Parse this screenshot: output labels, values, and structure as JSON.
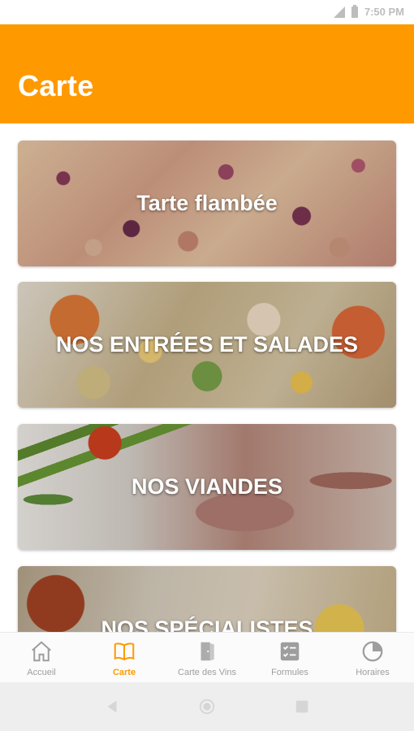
{
  "status_bar": {
    "time": "7:50 PM"
  },
  "app_bar": {
    "title": "Carte"
  },
  "colors": {
    "accent": "#ff9900",
    "inactive": "#9e9e9e"
  },
  "menu": [
    {
      "label": "Tarte flambée"
    },
    {
      "label": "NOS ENTRÉES ET SALADES"
    },
    {
      "label": "NOS VIANDES"
    },
    {
      "label": "NOS SPÉCIALISTES"
    }
  ],
  "bottom_nav": [
    {
      "label": "Accueil",
      "icon": "home-icon",
      "active": false
    },
    {
      "label": "Carte",
      "icon": "book-icon",
      "active": true
    },
    {
      "label": "Carte des Vins",
      "icon": "door-icon",
      "active": false
    },
    {
      "label": "Formules",
      "icon": "checklist-icon",
      "active": false
    },
    {
      "label": "Horaires",
      "icon": "clock-icon",
      "active": false
    }
  ],
  "system_nav": {
    "icons": [
      "back-icon",
      "home-circle-icon",
      "recents-icon"
    ]
  }
}
